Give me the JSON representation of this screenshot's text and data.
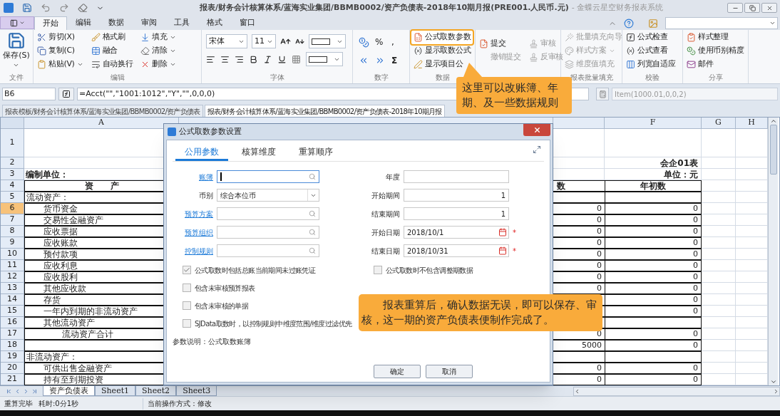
{
  "window": {
    "title": "报表/财务会计核算体系/蓝海实业集团/BBMB0002/资产负债表-2018年10期月报(PRE001.人民币.元)",
    "app_name": "- 金蝶云星空财务报表系统"
  },
  "ribbon_tabs": [
    {
      "label": "开始",
      "selected": true
    },
    {
      "label": "编辑",
      "selected": false
    },
    {
      "label": "数据",
      "selected": false
    },
    {
      "label": "审阅",
      "selected": false
    },
    {
      "label": "工具",
      "selected": false
    },
    {
      "label": "格式",
      "selected": false
    },
    {
      "label": "窗口",
      "selected": false
    }
  ],
  "ribbon_groups": [
    {
      "kind": "large",
      "label": "文件",
      "items": [
        {
          "label": "保存(S)",
          "menu": true
        }
      ]
    },
    {
      "kind": "small",
      "label": "编辑",
      "items": [
        {
          "label": "剪切(X)",
          "menu": false
        },
        {
          "label": "复制(C)",
          "menu": false
        },
        {
          "label": "粘贴(V)",
          "menu": true
        },
        {
          "label": "格式刷",
          "menu": false
        },
        {
          "label": "融合",
          "menu": false
        },
        {
          "label": "自动换行",
          "menu": false
        },
        {
          "label": "填充",
          "menu": true
        },
        {
          "label": "清除",
          "menu": true
        },
        {
          "label": "删除",
          "menu": true
        }
      ]
    },
    {
      "kind": "font",
      "label": "字体",
      "font": "宋体",
      "size": "11"
    },
    {
      "kind": "number",
      "label": "数字",
      "symbols": [
        "%",
        ",",
        "Σ"
      ]
    },
    {
      "kind": "small",
      "label": "数据",
      "items": [
        {
          "label": "公式取数参数",
          "highlighted": true
        },
        {
          "label": "显示取数公式",
          "highlighted": false
        },
        {
          "label": "显示项目公",
          "highlighted": false
        }
      ]
    },
    {
      "kind": "pairs",
      "items": [
        {
          "label": "提交",
          "disabled": false
        },
        {
          "label": "撤销提交",
          "disabled": true
        },
        {
          "label": "审核",
          "disabled": true
        },
        {
          "label": "反审核",
          "disabled": true
        }
      ]
    },
    {
      "kind": "small",
      "label": "报表批量填充",
      "items": [
        {
          "label": "批量填充向导",
          "disabled": true,
          "menu": false
        },
        {
          "label": "样式方案",
          "disabled": true,
          "menu": true
        },
        {
          "label": "维度值填充",
          "disabled": true,
          "menu": false
        }
      ]
    },
    {
      "kind": "small",
      "label": "校验",
      "items": [
        {
          "label": "公式检查"
        },
        {
          "label": "公式查看"
        },
        {
          "label": "列宽自适应"
        }
      ]
    },
    {
      "kind": "small",
      "label": "分享",
      "items": [
        {
          "label": "样式整理"
        },
        {
          "label": "使用币别精度"
        },
        {
          "label": "邮件"
        }
      ]
    }
  ],
  "formula_bar": {
    "cell": "B6",
    "formula": "=Acct(\"\",\"1001:1012\",\"Y\",\"\",0,0,0)",
    "item_formula": "Item(1000.01,0,0,2)"
  },
  "document_tabs": [
    {
      "label": "报表模板/财务会计核算体系/蓝海实业集团/BBMB0002/资产负债表",
      "selected": false
    },
    {
      "label": "报表/财务会计核算体系/蓝海实业集团/BBMB0002/资产负债表-2018年10期月报",
      "selected": true
    }
  ],
  "sheet": {
    "column_headers": [
      "A",
      "F",
      "G",
      "H"
    ],
    "rows": [
      {
        "number": "1",
        "kind": "blank",
        "selected": false,
        "framed": false
      },
      {
        "number": "2",
        "kind": "title",
        "selected": false,
        "framed": false,
        "value_2": "会企01表"
      },
      {
        "number": "3",
        "kind": "title",
        "selected": false,
        "framed": false,
        "label": "编制单位：",
        "value_2": "单位：元"
      },
      {
        "number": "4",
        "kind": "header",
        "selected": false,
        "framed": true,
        "label": "资　　产",
        "value_1": "数",
        "value_2": "年初数"
      },
      {
        "number": "5",
        "kind": "section",
        "selected": false,
        "framed": true,
        "label": "流动资产："
      },
      {
        "number": "6",
        "kind": "item",
        "selected": true,
        "framed": true,
        "label": "货币资金",
        "value_1": "0",
        "value_2": "0"
      },
      {
        "number": "7",
        "kind": "item",
        "selected": false,
        "framed": true,
        "label": "交易性金融资产",
        "value_1": "0",
        "value_2": "0"
      },
      {
        "number": "8",
        "kind": "item",
        "selected": false,
        "framed": true,
        "label": "应收票据",
        "value_1": "0",
        "value_2": "0"
      },
      {
        "number": "9",
        "kind": "item",
        "selected": false,
        "framed": true,
        "label": "应收账款",
        "value_1": "0",
        "value_2": "0"
      },
      {
        "number": "10",
        "kind": "item",
        "selected": false,
        "framed": true,
        "label": "预付款项",
        "value_1": "0",
        "value_2": "0"
      },
      {
        "number": "11",
        "kind": "item",
        "selected": false,
        "framed": true,
        "label": "应收利息",
        "value_1": "0",
        "value_2": "0"
      },
      {
        "number": "12",
        "kind": "item",
        "selected": false,
        "framed": true,
        "label": "应收股利",
        "value_1": "0",
        "value_2": "0"
      },
      {
        "number": "13",
        "kind": "item",
        "selected": false,
        "framed": true,
        "label": "其他应收款",
        "value_1": "0",
        "value_2": "0"
      },
      {
        "number": "14",
        "kind": "item",
        "selected": false,
        "framed": true,
        "label": "存货",
        "value_2": "0"
      },
      {
        "number": "15",
        "kind": "item",
        "selected": false,
        "framed": true,
        "label": "一年内到期的非流动资产",
        "value_2": "0"
      },
      {
        "number": "16",
        "kind": "item",
        "selected": false,
        "framed": true,
        "label": "其他流动资产"
      },
      {
        "number": "17",
        "kind": "total",
        "selected": false,
        "framed": true,
        "label": "流动资产合计",
        "value_1": "0",
        "value_2": "0"
      },
      {
        "number": "18",
        "kind": "item",
        "selected": false,
        "framed": true,
        "value_1": "5000",
        "value_2": "0"
      },
      {
        "number": "19",
        "kind": "section",
        "selected": false,
        "framed": true,
        "label": "非流动资产："
      },
      {
        "number": "20",
        "kind": "item",
        "selected": false,
        "framed": true,
        "label": "可供出售金融资产",
        "value_1": "0",
        "value_2": "0"
      },
      {
        "number": "21",
        "kind": "item",
        "selected": false,
        "framed": true,
        "label": "持有至到期投资",
        "value_1": "0",
        "value_2": "0"
      }
    ]
  },
  "sheet_tabs": [
    {
      "label": "资产负债表",
      "selected": true
    },
    {
      "label": "Sheet1",
      "selected": false
    },
    {
      "label": "Sheet2",
      "selected": false
    },
    {
      "label": "Sheet3",
      "selected": false
    }
  ],
  "status_bar": {
    "items": [
      "重算完毕",
      "耗时:0分1秒"
    ],
    "mode": "当前操作方式：修改"
  },
  "dialog": {
    "title": "公式取数参数设置",
    "tabs": [
      {
        "label": "公用参数",
        "selected": true
      },
      {
        "label": "核算维度",
        "selected": false
      },
      {
        "label": "重算顺序",
        "selected": false
      }
    ],
    "left_fields": [
      {
        "label": "账簿",
        "link": true,
        "kind": "lookup",
        "focused": true
      },
      {
        "label": "币别",
        "link": false,
        "kind": "select",
        "focused": false,
        "value": "综合本位币"
      },
      {
        "label": "预算方案",
        "link": true,
        "kind": "lookup",
        "focused": false
      },
      {
        "label": "预算组织",
        "link": true,
        "kind": "lookup",
        "focused": false
      },
      {
        "label": "控制规则",
        "link": true,
        "kind": "lookup",
        "focused": false
      }
    ],
    "right_fields": [
      {
        "label": "年度",
        "kind": "number"
      },
      {
        "label": "开始期间",
        "kind": "number",
        "value": "1"
      },
      {
        "label": "结束期间",
        "kind": "number",
        "value": "1"
      },
      {
        "label": "开始日期",
        "kind": "date",
        "value": "2018/10/1",
        "required_mark": "*"
      },
      {
        "label": "结束日期",
        "kind": "date",
        "value": "2018/10/31",
        "required_mark": "*"
      }
    ],
    "left_checkboxes": [
      {
        "label": "公式取数时包括总账当前期间未过账凭证",
        "checked": true
      },
      {
        "label": "包含未审核预算报表",
        "checked": false
      },
      {
        "label": "包含未审核的单据",
        "checked": false
      },
      {
        "label": "SJData取数时，以控制规则中维度范围/维度过滤优先",
        "checked": false
      }
    ],
    "right_checkboxes": [
      {
        "label": "公式取数时不包含调整期数据",
        "checked": false
      }
    ],
    "note": "参数说明：公式取数账簿",
    "buttons": [
      "确定",
      "取消"
    ]
  },
  "callouts": [
    "这里可以改账簿、年期、及一些数据规则",
    "报表重算后，确认数据无误，即可以保存、审核，这一期的资产负债表便制作完成了。"
  ]
}
